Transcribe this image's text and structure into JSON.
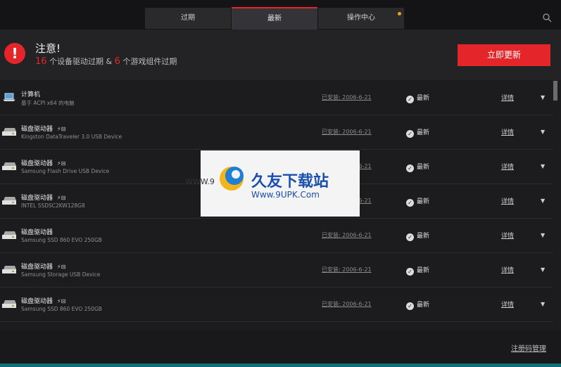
{
  "tabs": [
    {
      "label": "过期",
      "active": false
    },
    {
      "label": "最新",
      "active": true
    },
    {
      "label": "操作中心",
      "active": false,
      "badge_color": "#e8a41c"
    }
  ],
  "alert": {
    "title": "注意!",
    "device_count": "16",
    "device_text": " 个设备驱动过期 & ",
    "game_count": "6",
    "game_text": " 个游戏组件过期",
    "button": "立即更新"
  },
  "devices": [
    {
      "name": "计算机",
      "sub": "基于 ACPI x64 的电脑",
      "icon": "laptop-icon",
      "usb": false,
      "installed": "已安装: 2006-6-21",
      "status": "最新",
      "detail": "详情"
    },
    {
      "name": "磁盘驱动器",
      "sub": "Kingston DataTraveler 3.0 USB Device",
      "icon": "disk-drive-icon",
      "usb": true,
      "installed": "已安装: 2006-6-21",
      "status": "最新",
      "detail": "详情"
    },
    {
      "name": "磁盘驱动器",
      "sub": "Samsung Flash Drive USB Device",
      "icon": "disk-drive-icon",
      "usb": true,
      "installed": "已安装: 2006-6-21",
      "status": "最新",
      "detail": "详情"
    },
    {
      "name": "磁盘驱动器",
      "sub": "INTEL SSDSC2KW128G8",
      "icon": "disk-drive-icon",
      "usb": true,
      "installed": "已安装: 2006-6-21",
      "status": "最新",
      "detail": "详情"
    },
    {
      "name": "磁盘驱动器",
      "sub": "Samsung SSD 860 EVO 250GB",
      "icon": "disk-drive-icon",
      "usb": false,
      "installed": "已安装: 2006-6-21",
      "status": "最新",
      "detail": "详情"
    },
    {
      "name": "磁盘驱动器",
      "sub": "Samsung Storage USB Device",
      "icon": "disk-drive-icon",
      "usb": true,
      "installed": "已安装: 2006-6-21",
      "status": "最新",
      "detail": "详情"
    },
    {
      "name": "磁盘驱动器",
      "sub": "Samsung SSD 860 EVO 250GB",
      "icon": "disk-drive-icon",
      "usb": true,
      "installed": "已安装: 2006-6-21",
      "status": "最新",
      "detail": "详情"
    }
  ],
  "footer": {
    "link": "注册码管理"
  },
  "watermark": {
    "left": "WWW.9",
    "cn": "久友下载站",
    "url": "Www.9UPK.Com"
  },
  "colors": {
    "accent": "#e4262b",
    "background": "#1c1c1e"
  }
}
